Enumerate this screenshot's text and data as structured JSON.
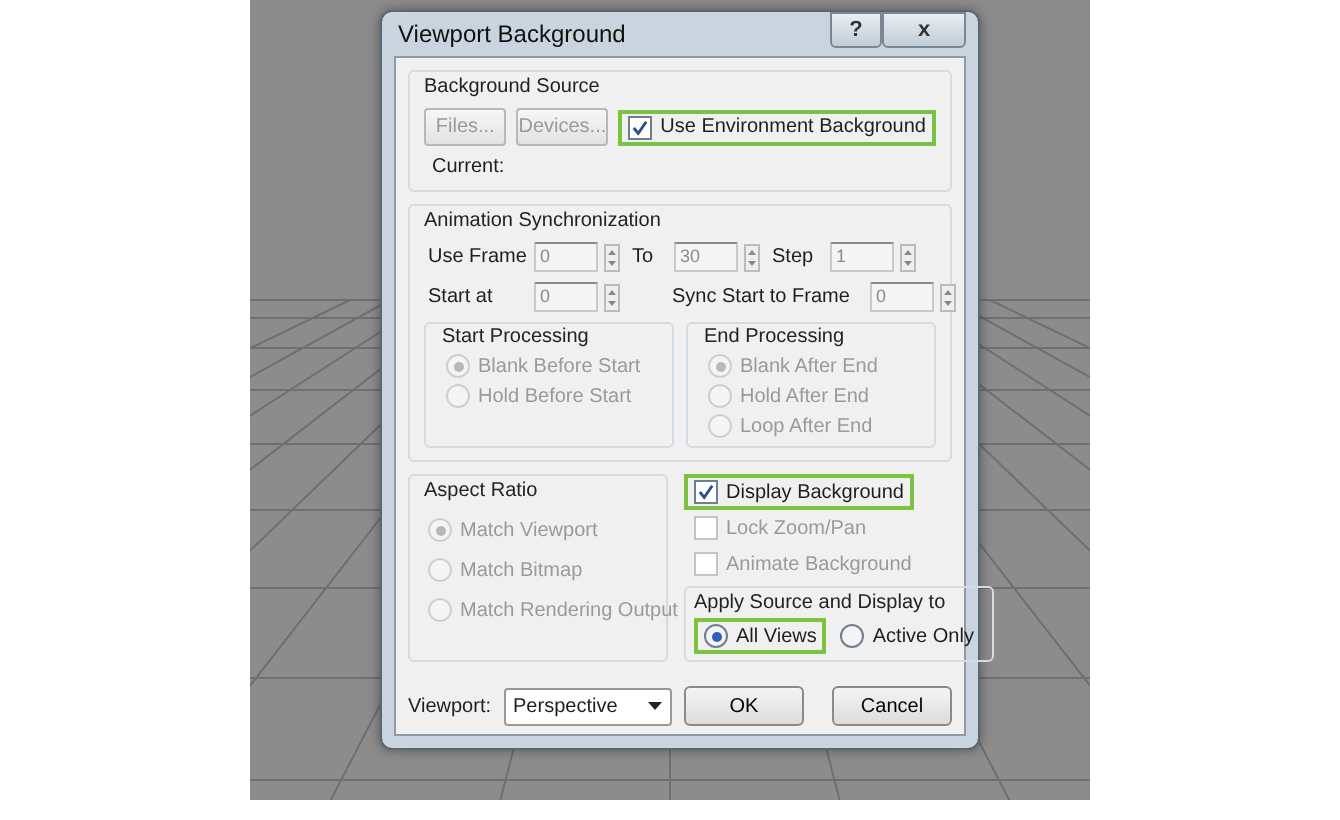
{
  "window": {
    "title": "Viewport Background",
    "help": "?",
    "close": "x"
  },
  "background_source": {
    "title": "Background Source",
    "buttons": [
      {
        "label": "Files...",
        "disabled": true
      },
      {
        "label": "Devices...",
        "disabled": true
      }
    ],
    "use_environment": {
      "label": "Use Environment Background",
      "checked": true,
      "disabled": false,
      "highlighted": true
    },
    "current_label": "Current:"
  },
  "animation_sync": {
    "title": "Animation Synchronization",
    "row_1": [
      {
        "label": "Use Frame",
        "value": "0",
        "disabled": true
      },
      {
        "label": "To",
        "value": "30",
        "disabled": true
      },
      {
        "label": "Step",
        "value": "1",
        "disabled": true
      }
    ],
    "row_2": [
      {
        "label": "Start at",
        "value": "0",
        "disabled": true
      },
      {
        "label": "Sync Start to Frame",
        "value": "0",
        "disabled": true
      }
    ],
    "start_processing": {
      "title": "Start Processing",
      "options": [
        {
          "label": "Blank Before Start",
          "selected": true,
          "disabled": true
        },
        {
          "label": "Hold Before Start",
          "selected": false,
          "disabled": true
        }
      ]
    },
    "end_processing": {
      "title": "End Processing",
      "options": [
        {
          "label": "Blank After End",
          "selected": true,
          "disabled": true
        },
        {
          "label": "Hold After End",
          "selected": false,
          "disabled": true
        },
        {
          "label": "Loop After End",
          "selected": false,
          "disabled": true
        }
      ]
    }
  },
  "aspect_ratio": {
    "title": "Aspect Ratio",
    "options": [
      {
        "label": "Match Viewport",
        "selected": true,
        "disabled": true
      },
      {
        "label": "Match Bitmap",
        "selected": false,
        "disabled": true
      },
      {
        "label": "Match Rendering Output",
        "selected": false,
        "disabled": true
      }
    ]
  },
  "display_options": [
    {
      "label": "Display Background",
      "checked": true,
      "disabled": false,
      "highlighted": true
    },
    {
      "label": "Lock Zoom/Pan",
      "checked": false,
      "disabled": true,
      "highlighted": false
    },
    {
      "label": "Animate Background",
      "checked": false,
      "disabled": true,
      "highlighted": false
    }
  ],
  "apply_to": {
    "title": "Apply Source and Display to",
    "options": [
      {
        "label": "All Views",
        "selected": true,
        "disabled": false,
        "highlighted": true
      },
      {
        "label": "Active Only",
        "selected": false,
        "disabled": false,
        "highlighted": false
      }
    ]
  },
  "viewport": {
    "label": "Viewport:",
    "value": "Perspective"
  },
  "buttons": [
    "OK",
    "Cancel"
  ]
}
